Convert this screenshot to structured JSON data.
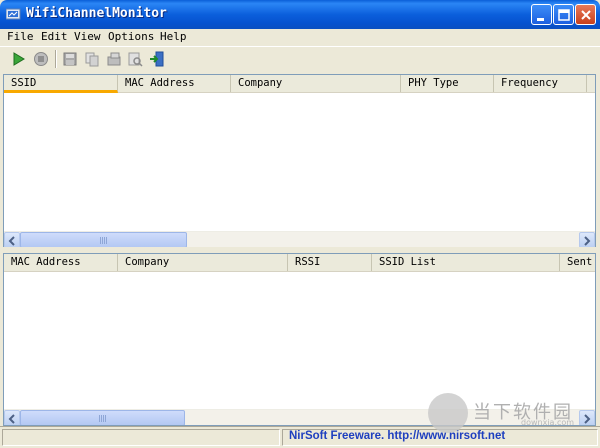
{
  "window": {
    "title": "WifiChannelMonitor"
  },
  "menu": [
    "File",
    "Edit",
    "View",
    "Options",
    "Help"
  ],
  "toolbar": {
    "icons": [
      "play-icon",
      "stop-icon",
      "save-icon",
      "copy-icon",
      "properties-icon",
      "find-icon",
      "exit-icon"
    ]
  },
  "top_table": {
    "columns": [
      "SSID",
      "MAC Address",
      "Company",
      "PHY Type",
      "Frequency",
      ""
    ],
    "sorted_column": "SSID",
    "rows": []
  },
  "bottom_table": {
    "columns": [
      "MAC Address",
      "Company",
      "RSSI",
      "SSID List",
      "Sent I"
    ],
    "rows": []
  },
  "status": {
    "link_text": "NirSoft Freeware.  http://www.nirsoft.net"
  },
  "watermark": {
    "brand": "当下软件园",
    "domain": "downxia.com"
  },
  "colors": {
    "titlebar": "#0a5fd8",
    "link": "#1e3fbf",
    "sort_marker": "#f8a900"
  }
}
